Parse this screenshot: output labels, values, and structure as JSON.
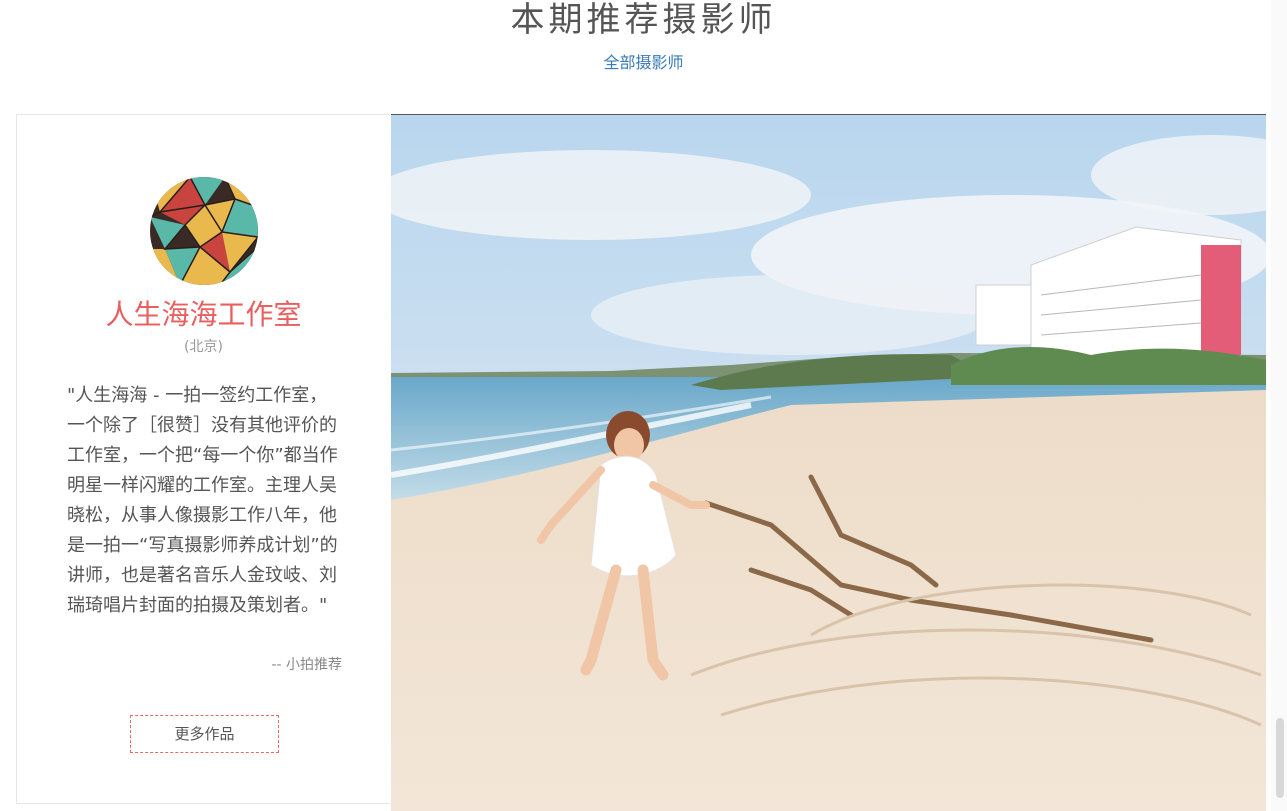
{
  "header": {
    "title": "本期推荐摄影师",
    "all_link": "全部摄影师"
  },
  "photographer": {
    "name": "人生海海工作室",
    "location": "(北京)",
    "quote": "\"人生海海 - 一拍一签约工作室，一个除了［很赞］没有其他评价的工作室，一个把“每一个你”都当作明星一样闪耀的工作室。主理人吴晓松，从事人像摄影工作八年，他是一拍一“写真摄影师养成计划”的讲师，也是著名音乐人金玟岐、刘瑞琦唱片封面的拍摄及策划者。\"",
    "recommended_by": "-- 小拍推荐",
    "more_button": "更多作品"
  },
  "colors": {
    "accent": "#e85f5f",
    "link": "#3a7ab8"
  },
  "icons": {
    "avatar": "geometric-triangle-avatar-icon"
  }
}
